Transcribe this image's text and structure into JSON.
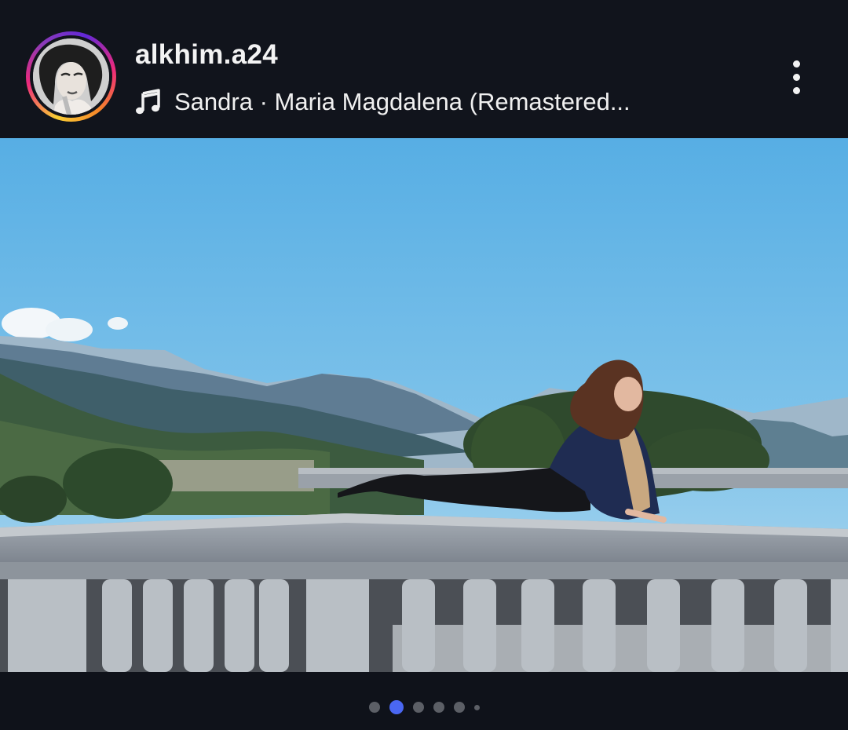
{
  "post": {
    "username": "alkhim.a24",
    "audio_text": "Sandra · Maria Magdalena (Remastered..."
  },
  "icons": {
    "music": "music-note-icon",
    "more": "more-vertical-icon"
  },
  "carousel": {
    "total_dots": 6,
    "active_index": 1
  },
  "colors": {
    "background": "#0f121a",
    "active_dot": "#4a67f2",
    "inactive_dot": "#5c5f66"
  }
}
